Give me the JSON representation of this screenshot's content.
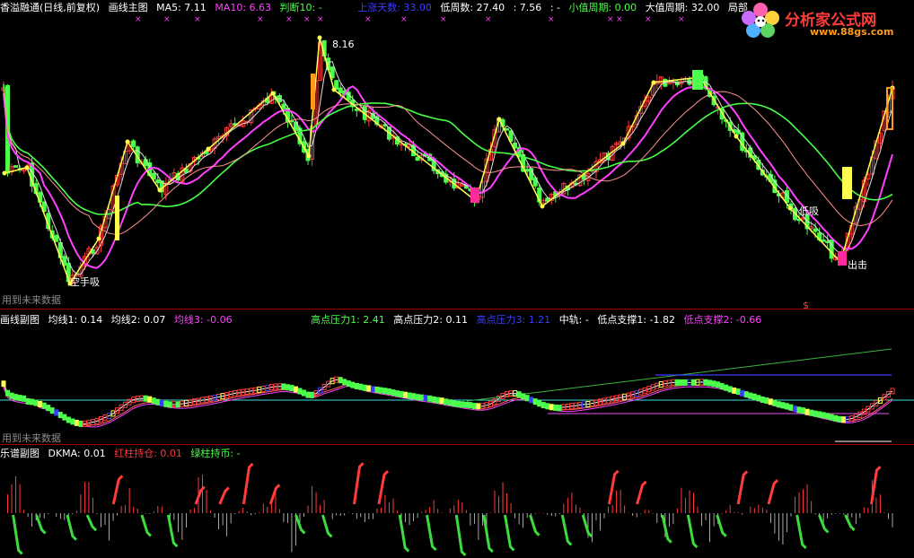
{
  "colors": {
    "white": "#ffffff",
    "magenta": "#ff40ff",
    "green": "#46ff46",
    "blue": "#3c3cff",
    "yellow": "#ffff50",
    "red": "#ff3b3b",
    "bull": "#ff3b3b",
    "bear": "#4cff4c"
  },
  "main": {
    "title": "香溢融通(日线,前复权)",
    "indicator": "画线主图",
    "ma5": "MA5: 7.11",
    "ma10": "MA10: 6.63",
    "judge": "判断10: -",
    "up_days": "上涨天数: 33.00",
    "low_cycle": "低周数: 27.40",
    "value": ": 7.56",
    "dash": ": -",
    "small_cycle": "小值周期: 0.00",
    "big_cycle": "大值周期: 32.00",
    "local": "局部",
    "peak_label": "8.16",
    "buy_label_1": "空手吸",
    "low_buy": "低吸",
    "sell_label": "出击",
    "future_note": "用到未来数据",
    "dollar": "$"
  },
  "sub1": {
    "indicator": "画线副图",
    "avg1": "均线1: 0.14",
    "avg2": "均线2: 0.07",
    "avg3": "均线3: -0.06",
    "high_pressure1": "高点压力1: 2.41",
    "high_pressure2": "高点压力2: 0.11",
    "high_pressure3": "高点压力3: 1.21",
    "mid_track": "中轨: -",
    "low_support1": "低点支撑1: -1.82",
    "low_support2": "低点支撑2: -0.66",
    "future_note": "用到未来数据"
  },
  "sub2": {
    "indicator": "乐谱副图",
    "dkma": "DKMA: 0.01",
    "red_hold": "红柱持仓: 0.01",
    "green_hold": "绿柱持币: -"
  },
  "logo": {
    "text": "分析家公式网",
    "url": "www.88gs.com",
    "flower_icon": "flower-icon"
  }
}
